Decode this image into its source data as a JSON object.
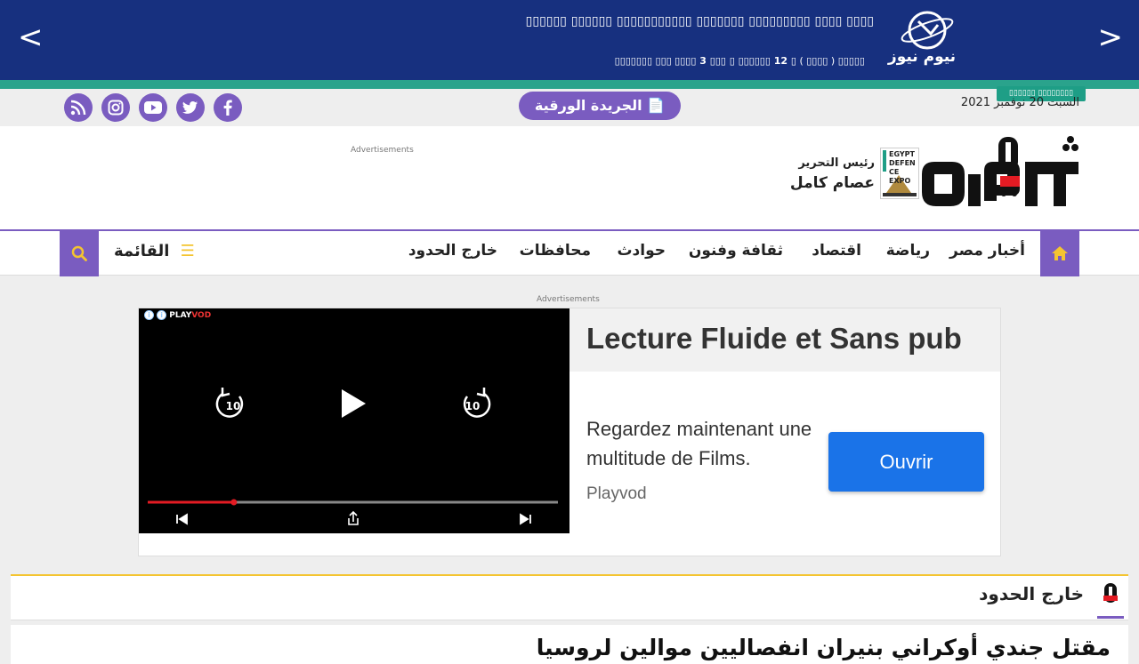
{
  "ticker": {
    "prev_arrow": "<",
    "next_arrow": ">",
    "brand": "نيوم نيوز",
    "headline": "▯▯▯▯ ▯▯▯▯ ▯▯▯▯▯▯▯▯▯ ▯▯▯▯▯▯▯ ▯▯▯▯▯▯▯▯▯▯▯ ▯▯▯▯▯▯ ▯▯▯▯▯▯",
    "meta_source": "▯▯▯▯▯ ( ▯▯▯▯ )",
    "meta_date": "▯ 12 ▯▯▯▯▯▯ ▯ ▯▯▯ 3 ▯▯▯▯",
    "meta_author": "▯▯▯ ▯▯▯▯▯▯▯"
  },
  "topbar": {
    "latest_badge": "▯▯▯▯▯▯ ▯▯▯▯▯▯▯▯",
    "date": "السبت 20 نوفمبر 2021",
    "paper_button": "📄 الجريدة الورقية",
    "social_icons": [
      "facebook-icon",
      "twitter-icon",
      "youtube-icon",
      "instagram-icon",
      "rss-icon"
    ]
  },
  "header": {
    "ad_label": "Advertisements",
    "editor_title": "رئيس التحرير",
    "editor_name": "عصام كامل",
    "expo_text": "EGYPT DEFENCE EXPO"
  },
  "nav": {
    "items": [
      "أخبار مصر",
      "رياضة",
      "اقتصاد",
      "ثقافة وفنون",
      "حوادث",
      "محافظات",
      "خارج الحدود"
    ],
    "menu_label": "القائمة"
  },
  "ad": {
    "label": "Advertisements",
    "video_brand_play": "PLAY",
    "video_brand_vod": "VOD",
    "headline": "Lecture Fluide et Sans pub",
    "body": "Regardez maintenant une multitude de Films.",
    "brand": "Playvod",
    "cta": "Ouvrir",
    "rewind_label": "10",
    "forward_label": "10",
    "progress": 0.21
  },
  "section": {
    "title": "خارج الحدود",
    "article_title": "مقتل جندي أوكراني بنيران انفصاليين موالين لروسيا"
  },
  "colors": {
    "ticker_bg": "#17307f",
    "accent": "#7a5cc0",
    "teal": "#2aa38c",
    "yellow": "#f4c430",
    "cta": "#1a73e8"
  }
}
